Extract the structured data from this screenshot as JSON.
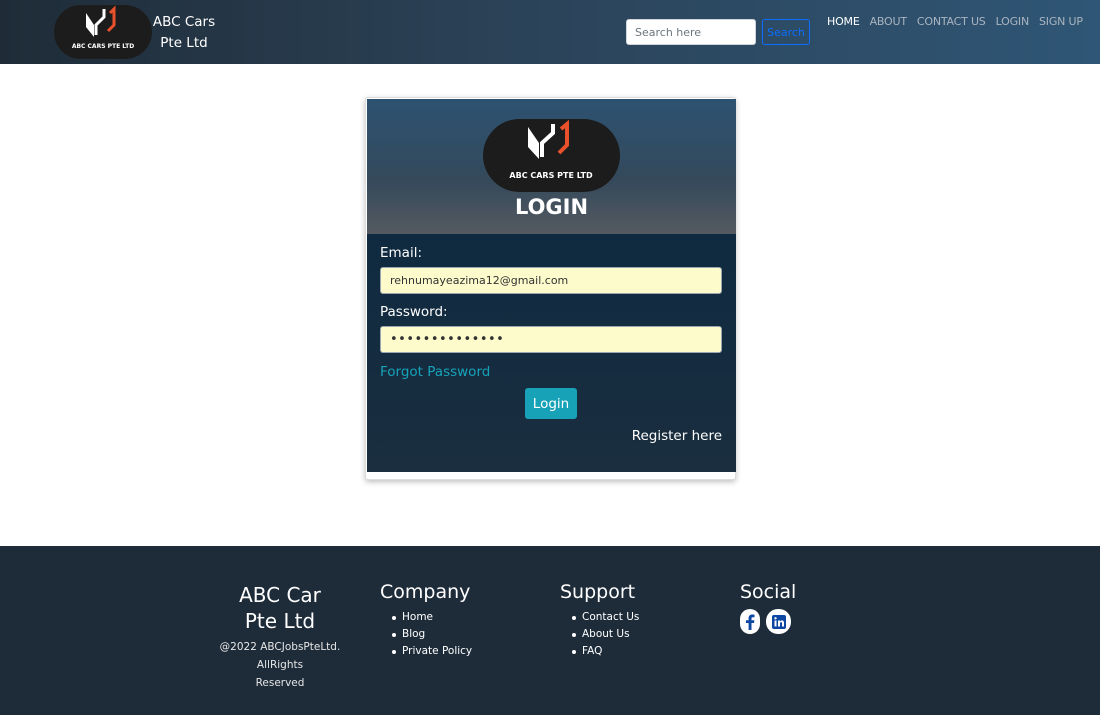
{
  "navbar": {
    "brand_line1": "ABC Cars",
    "brand_line2": "Pte Ltd",
    "logo_caption": "ABC CARS PTE LTD",
    "search_placeholder": "Search here",
    "search_label": "Search",
    "links": [
      "HOME",
      "ABOUT",
      "CONTACT US",
      "LOGIN",
      "SIGN UP"
    ],
    "active_link": "HOME"
  },
  "login": {
    "logo_caption": "ABC CARS PTE LTD",
    "title": "LOGIN",
    "email_label": "Email:",
    "email_value": "rehnumayeazima12@gmail.com",
    "password_label": "Password:",
    "password_mask": "••••••••••••••",
    "forgot_label": "Forgot Password",
    "submit_label": "Login",
    "register_label": "Register here"
  },
  "footer": {
    "brand_line1": "ABC Car",
    "brand_line2": "Pte Ltd",
    "copyright_line1": "@2022 ABCJobsPteLtd. AllRights",
    "copyright_line2": "Reserved",
    "company": {
      "heading": "Company",
      "items": [
        "Home",
        "Blog",
        "Private Policy"
      ]
    },
    "support": {
      "heading": "Support",
      "items": [
        "Contact Us",
        "About Us",
        "FAQ"
      ]
    },
    "social": {
      "heading": "Social",
      "icons": [
        "facebook-icon",
        "linkedin-icon"
      ]
    }
  },
  "colors": {
    "accent_teal": "#17a2b8",
    "search_blue": "#0d6efd",
    "footer_bg": "#1e2c3a",
    "input_bg": "#fdfbcc",
    "logo_red": "#e8512b"
  }
}
